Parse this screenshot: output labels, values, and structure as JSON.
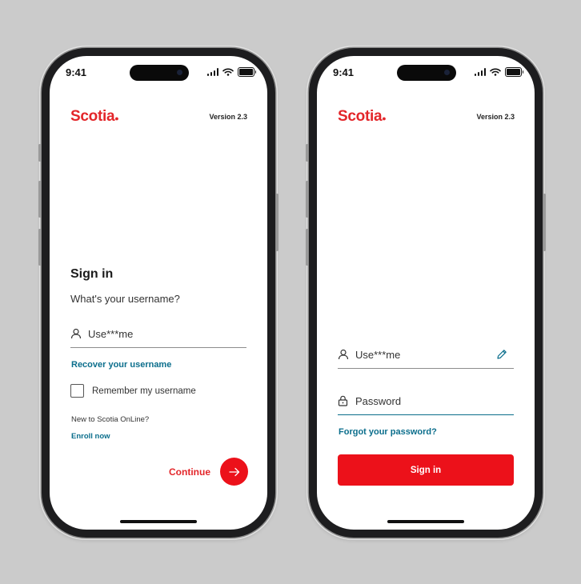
{
  "status_bar": {
    "time": "9:41"
  },
  "brand": {
    "logo": "Scotia",
    "logo_dot": "●",
    "version": "Version 2.3",
    "color": "#e3262a",
    "link_color": "#0b6e8c"
  },
  "screen1": {
    "title": "Sign in",
    "subtitle": "What's your username?",
    "username_value": "Use***me",
    "recover_link": "Recover your username",
    "remember_label": "Remember my username",
    "remember_checked": false,
    "new_text": "New to Scotia OnLine?",
    "enroll_link": "Enroll now",
    "continue_label": "Continue"
  },
  "screen2": {
    "username_value": "Use***me",
    "password_placeholder": "Password",
    "forgot_link": "Forgot your password?",
    "signin_label": "Sign in"
  },
  "icons": [
    "person-icon",
    "pencil-icon",
    "lock-icon",
    "arrow-right-icon",
    "signal-icon",
    "wifi-icon",
    "battery-icon"
  ]
}
